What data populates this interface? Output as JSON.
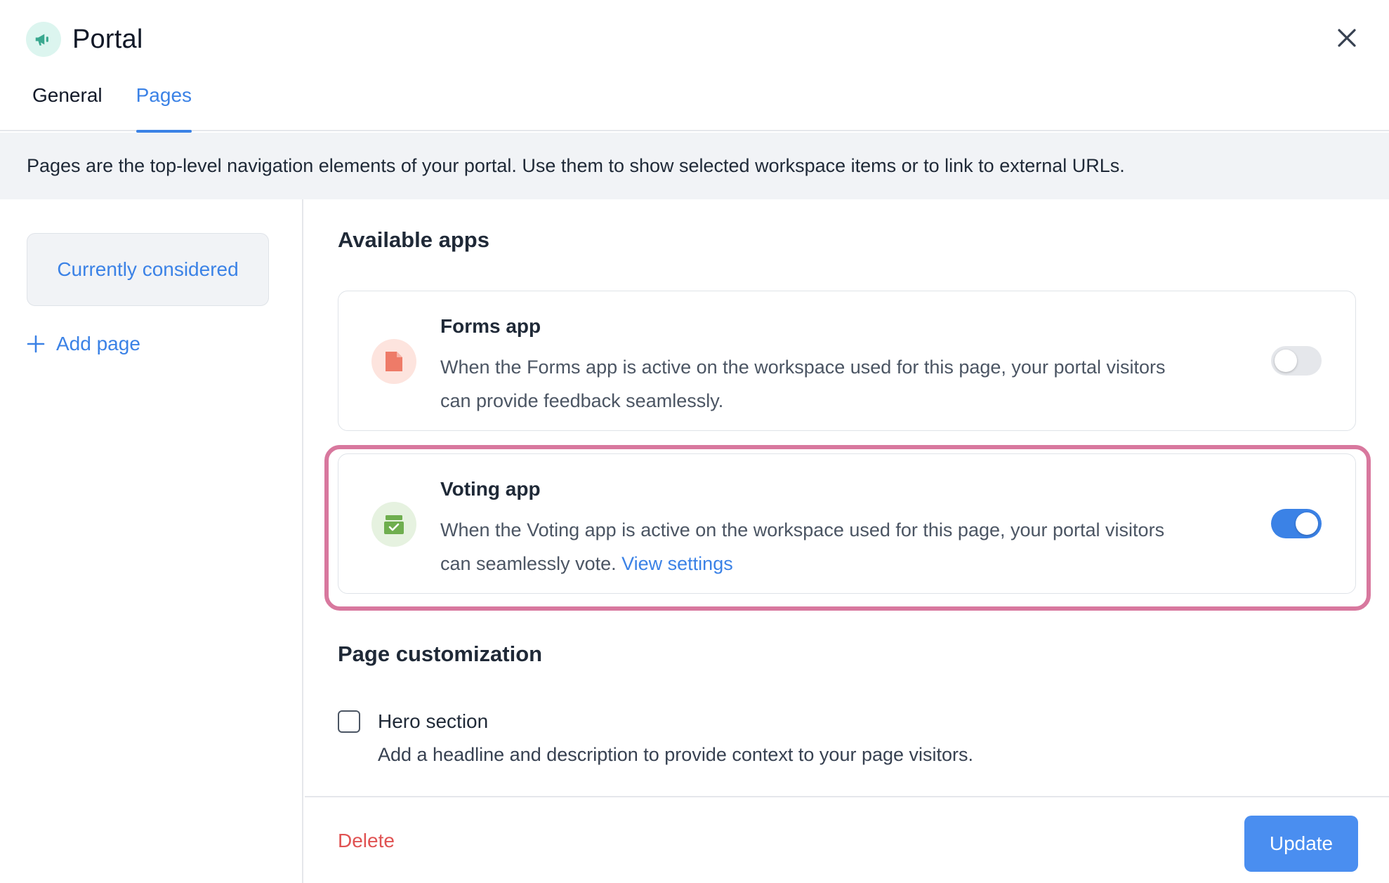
{
  "header": {
    "title": "Portal",
    "tabs": [
      {
        "label": "General",
        "active": false
      },
      {
        "label": "Pages",
        "active": true
      }
    ]
  },
  "banner": {
    "text": "Pages are the top-level navigation elements of your portal. Use them to show selected workspace items or to link to external URLs."
  },
  "sidebar": {
    "pages": [
      {
        "label": "Currently considered",
        "selected": true
      }
    ],
    "add_page_label": "Add page"
  },
  "main": {
    "available_apps_title": "Available apps",
    "apps": [
      {
        "name": "Forms app",
        "description": "When the Forms app is active on the workspace used for this page, your portal visitors can provide feedback seamlessly.",
        "icon": "document-icon",
        "enabled": false
      },
      {
        "name": "Voting app",
        "description": "When the Voting app is active on the workspace used for this page, your portal visitors can seamlessly vote.",
        "link_label": "View settings",
        "icon": "ballot-box-icon",
        "enabled": true
      }
    ],
    "page_customization_title": "Page customization",
    "hero": {
      "label": "Hero section",
      "description": "Add a headline and description to provide context to your page visitors.",
      "checked": false
    }
  },
  "footer": {
    "delete_label": "Delete",
    "update_label": "Update"
  },
  "colors": {
    "accent": "#3b82e6",
    "danger": "#e05252",
    "highlight": "#d8789e",
    "forms_icon": "#ee7b68",
    "voting_icon": "#6fae4f"
  }
}
